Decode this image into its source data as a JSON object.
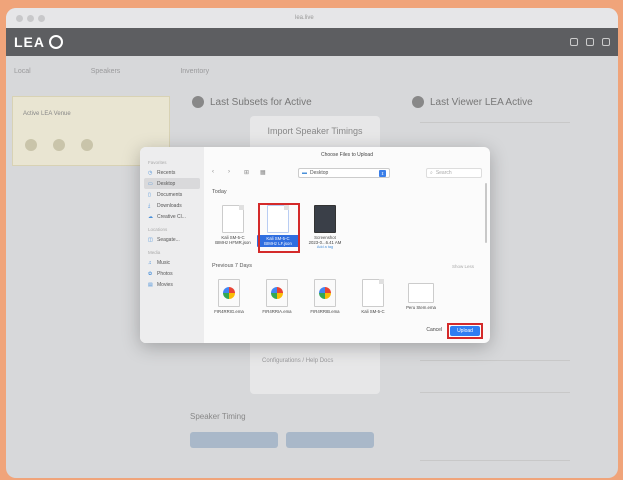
{
  "browser": {
    "url": "lea.live"
  },
  "app": {
    "logo_text": "LEA"
  },
  "background": {
    "nav": [
      "Local",
      "Speakers",
      "Inventory"
    ],
    "card_title": "Active LEA Venue",
    "section_left_title": "Last Subsets for Active",
    "section_right_title": "Last Viewer LEA Active",
    "import_panel_title": "Import Speaker Timings",
    "checkbox_label": "Configurations / Help Docs",
    "speaker_timing_title": "Speaker Timing"
  },
  "dialog": {
    "title": "Choose Files to Upload",
    "location": "Desktop",
    "search_placeholder": "Search",
    "sidebar": {
      "favorites_label": "Favorites",
      "favorites": [
        {
          "icon": "clock-icon",
          "label": "Recents"
        },
        {
          "icon": "desktop-icon",
          "label": "Desktop"
        },
        {
          "icon": "document-icon",
          "label": "Documents"
        },
        {
          "icon": "download-icon",
          "label": "Downloads"
        },
        {
          "icon": "cloud-icon",
          "label": "Creative Cl..."
        }
      ],
      "locations_label": "Locations",
      "locations": [
        {
          "icon": "disk-icon",
          "label": "Seagate..."
        }
      ],
      "media_label": "Media",
      "media": [
        {
          "icon": "music-icon",
          "label": "Music"
        },
        {
          "icon": "photo-icon",
          "label": "Photos"
        },
        {
          "icon": "film-icon",
          "label": "Movies"
        }
      ]
    },
    "today_label": "Today",
    "today_files": [
      {
        "line1": "Kali SM-5-C",
        "line2": "BIMHz HFMR.json",
        "sub": "",
        "kind": "doc",
        "selected": false
      },
      {
        "line1": "Kali SM-5-C",
        "line2": "BIMHz LF.json",
        "sub": "",
        "kind": "doc",
        "selected": true
      },
      {
        "line1": "Screenshot",
        "line2": "2023-0...6.41 AM",
        "sub": "Add a tag",
        "kind": "img",
        "selected": false
      }
    ],
    "previous_label": "Previous 7 Days",
    "show_less": "Show Less",
    "previous_files": [
      {
        "line1": "FIR4RRIG.ema",
        "kind": "jpg"
      },
      {
        "line1": "FIR4RRIA.ema",
        "kind": "jpg"
      },
      {
        "line1": "FIR4RRIB.ema",
        "kind": "jpg"
      },
      {
        "line1": "Kali SM-5-C",
        "kind": "doc"
      },
      {
        "line1": "Peru Stem.ema",
        "kind": "pdf"
      }
    ],
    "cancel_label": "Cancel",
    "upload_label": "Upload"
  }
}
